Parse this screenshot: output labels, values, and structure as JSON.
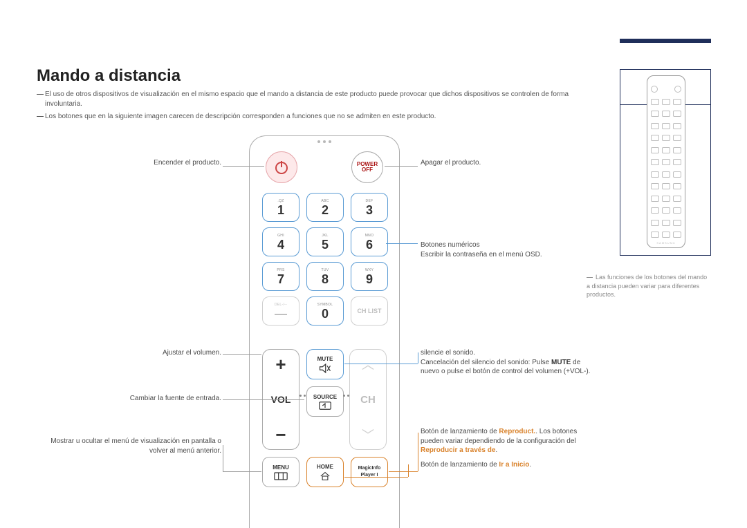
{
  "title": "Mando a distancia",
  "intro": {
    "bullet1": "El uso de otros dispositivos de visualización en el mismo espacio que el mando a distancia de este producto puede provocar que dichos dispositivos se controlen de forma involuntaria.",
    "bullet2": "Los botones que en la siguiente imagen carecen de descripción corresponden a funciones que no se admiten en este producto."
  },
  "thumb_note": "Las funciones de los botones del mando a distancia pueden variar para diferentes productos.",
  "thumb_brand": "SAMSUNG",
  "remote": {
    "power_off": {
      "line1": "POWER",
      "line2": "OFF"
    },
    "numpad": {
      "subs": [
        ".QZ",
        "ABC",
        "DEF",
        "GHI",
        "JKL",
        "MNO",
        "PRS",
        "TUV",
        "WXY",
        "DEL-/--",
        "SYMBOL",
        ""
      ],
      "nums": [
        "1",
        "2",
        "3",
        "4",
        "5",
        "6",
        "7",
        "8",
        "9",
        "—",
        "0",
        ""
      ]
    },
    "chlist": "CH LIST",
    "vol": {
      "label": "VOL",
      "plus": "+",
      "minus": "−"
    },
    "ch": {
      "label": "CH"
    },
    "mute": "MUTE",
    "source": "SOURCE",
    "menu": "MENU",
    "home": "HOME",
    "magicinfo": {
      "l1": "MagicInfo",
      "l2": "Player I"
    }
  },
  "left": {
    "power_on": "Encender el producto.",
    "volume": "Ajustar el volumen.",
    "source": "Cambiar la fuente de entrada.",
    "menu": "Mostrar u ocultar el menú de visualización en pantalla o volver al menú anterior."
  },
  "right": {
    "power_off": "Apagar el producto.",
    "numeric_l1": "Botones numéricos",
    "numeric_l2": "Escribir la contraseña en el menú OSD.",
    "mute_l1": "silencie el sonido.",
    "mute_l2a": "Cancelación del silencio del sonido: Pulse ",
    "mute_l2b": "MUTE",
    "mute_l2c": " de nuevo o pulse el botón de control del volumen (+VOL-).",
    "magic_l1a": "Botón de lanzamiento de ",
    "magic_l1b": "Reproduct.",
    "magic_l1c": ". Los botones pueden variar dependiendo de la configuración del ",
    "magic_l1d": "Reproducir a través de",
    "magic_l1e": ".",
    "home_a": "Botón de lanzamiento de ",
    "home_b": "Ir a Inicio",
    "home_c": "."
  }
}
